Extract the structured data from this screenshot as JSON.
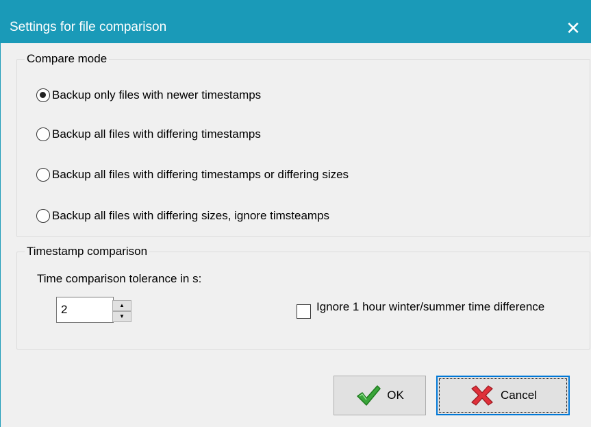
{
  "window": {
    "title": "Settings for file comparison",
    "close_glyph": "✕",
    "title_bar_color": "#1a9ab8"
  },
  "compare_mode": {
    "label": "Compare mode",
    "selected_index": 0,
    "options": [
      "Backup only files with newer timestamps",
      "Backup all files with differing timestamps",
      "Backup all files with differing timestamps or differing sizes",
      "Backup all files with differing sizes, ignore timsteamps"
    ]
  },
  "timestamp_comparison": {
    "label": "Timestamp comparison",
    "tolerance_label": "Time comparison tolerance in s:",
    "tolerance_value": "2",
    "ignore_dst_label": "Ignore 1 hour winter/summer time difference",
    "ignore_dst_checked": false
  },
  "buttons": {
    "ok_label": "OK",
    "ok_icon": "green-checkmark-icon",
    "cancel_label": "Cancel",
    "cancel_icon": "red-x-icon"
  }
}
